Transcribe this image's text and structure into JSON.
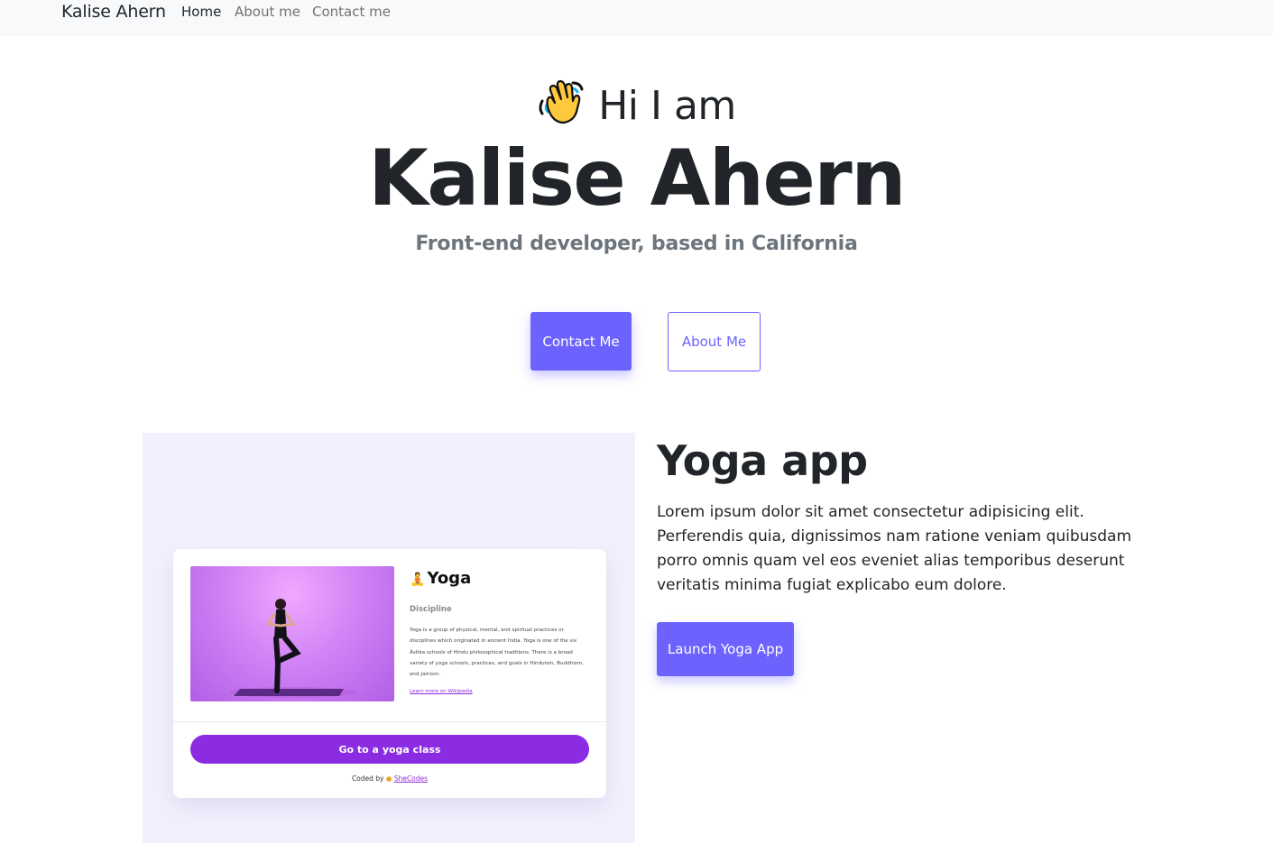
{
  "nav": {
    "brand": "Kalise Ahern",
    "links": [
      {
        "label": "Home",
        "active": true
      },
      {
        "label": "About me",
        "active": false
      },
      {
        "label": "Contact me",
        "active": false
      }
    ]
  },
  "hero": {
    "greeting": "Hi I am",
    "name": "Kalise Ahern",
    "subtitle": "Front-end developer, based in California",
    "primary_button": "Contact Me",
    "secondary_button": "About Me",
    "greeting_icon": "waving-hand-icon"
  },
  "project": {
    "title": "Yoga app",
    "description": "Lorem ipsum dolor sit amet consectetur adipisicing elit. Perferendis quia, dignissimos nam ratione veniam quibusdam porro omnis quam vel eos eveniet alias temporibus deserunt veritatis minima fugiat explicabo eum dolore.",
    "button": "Launch Yoga App",
    "preview": {
      "title": "Yoga",
      "icon": "lotus-icon",
      "subtitle": "Discipline",
      "description": "Yoga is a group of physical, mental, and spiritual practices or disciplines which originated in ancient India. Yoga is one of the six Āstika schools of Hindu philosophical traditions. There is a broad variety of yoga schools, practices, and goals in Hinduism, Buddhism, and Jainism.",
      "link": "Learn more on Wikipedia",
      "button": "Go to a yoga class",
      "coded_by": "Coded by",
      "coded_by_link": "SheCodes"
    }
  },
  "colors": {
    "accent": "#6c63ff",
    "preview_accent": "#8b2be2",
    "navbar_bg": "#f8f9fa",
    "project_bg": "#f3f0fd"
  }
}
